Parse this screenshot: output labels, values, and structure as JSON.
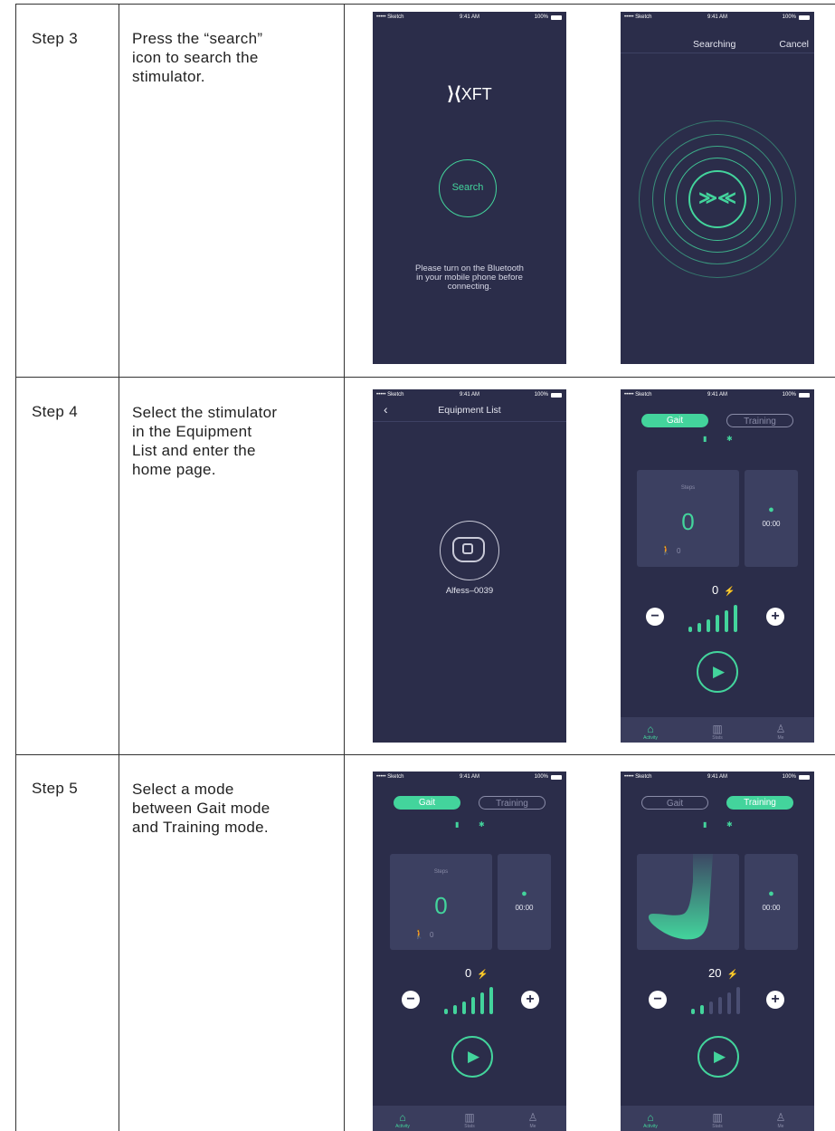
{
  "rows": [
    {
      "step": "Step 3",
      "desc": [
        "Press the “search”",
        "icon to search the",
        "stimulator."
      ]
    },
    {
      "step": "Step 4",
      "desc": [
        "Select the stimulator",
        "in the Equipment",
        "List and enter the",
        "home page."
      ]
    },
    {
      "step": "Step 5",
      "desc": [
        "Select a mode",
        "between Gait mode",
        "and Training mode."
      ]
    }
  ],
  "status": {
    "carrier": "••••• Sketch",
    "time": "9:41 AM",
    "battery": "100%"
  },
  "search_screen": {
    "logo": "XFT",
    "search_label": "Search",
    "message": [
      "Please turn on the Bluetooth",
      "in your mobile phone before",
      "connecting."
    ]
  },
  "searching_screen": {
    "title": "Searching",
    "cancel": "Cancel"
  },
  "equipment_screen": {
    "title": "Equipment List",
    "device": "Alfess–0039"
  },
  "home": {
    "tab_gait": "Gait",
    "tab_training": "Training",
    "steps_label": "Steps",
    "steps_value": "0",
    "walk_count": "0",
    "time": "00:00",
    "level_gait": "0",
    "level_training": "20",
    "nav": {
      "activity": "Activity",
      "stats": "Stats",
      "me": "Me"
    }
  },
  "colors": {
    "accent": "#43d49c",
    "phone_bg": "#2b2d4a",
    "card": "#3c4061"
  }
}
